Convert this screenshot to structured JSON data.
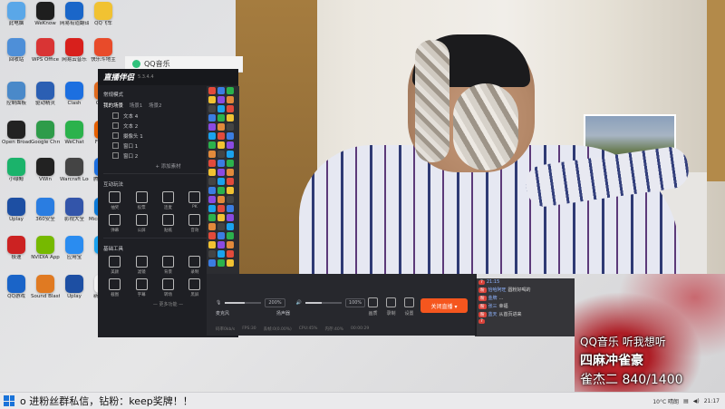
{
  "desktop_icons": [
    {
      "label": "此电脑",
      "icon": "computer-icon",
      "color": "#5aa7e8"
    },
    {
      "label": "WeKnow",
      "icon": "weknow-icon",
      "color": "#1e1e1e"
    },
    {
      "label": "网易有道翻译",
      "icon": "youdao-icon",
      "color": "#1a66c9"
    },
    {
      "label": "QQ飞车",
      "icon": "qq-speed-icon",
      "color": "#f1c232"
    },
    {
      "label": "回收站",
      "icon": "recycle-bin-icon",
      "color": "#4e8fd8"
    },
    {
      "label": "WPS Office",
      "icon": "wps-icon",
      "color": "#d93434"
    },
    {
      "label": "网易云音乐",
      "icon": "netease-music-icon",
      "color": "#d8201c"
    },
    {
      "label": "快乐斗地主",
      "icon": "doudizhu-icon",
      "color": "#e84b2a"
    },
    {
      "label": "控制面板",
      "icon": "control-panel-icon",
      "color": "#4a89c9"
    },
    {
      "label": "驱动精灵",
      "icon": "driver-icon",
      "color": "#2b5fb3"
    },
    {
      "label": "Clash",
      "icon": "clash-icon",
      "color": "#1c6fe0"
    },
    {
      "label": "Cpu-Z",
      "icon": "cpuz-icon",
      "color": "#e06a1e"
    },
    {
      "label": "Open Broadcast",
      "icon": "obs-icon",
      "color": "#222"
    },
    {
      "label": "Google Chrome",
      "icon": "chrome-icon",
      "color": "#2e9c4a"
    },
    {
      "label": "WeChat",
      "icon": "wechat-icon",
      "color": "#2bb24c"
    },
    {
      "label": "Firefox",
      "icon": "firefox-icon",
      "color": "#e66000"
    },
    {
      "label": "小绿鲸",
      "icon": "green-whale-icon",
      "color": "#1bb36b"
    },
    {
      "label": "VWin",
      "icon": "vwin-icon",
      "color": "#222"
    },
    {
      "label": "Warcraft Logs",
      "icon": "warcraft-icon",
      "color": "#444"
    },
    {
      "label": "腾讯会议",
      "icon": "tencent-meeting-icon",
      "color": "#1c6fe0"
    },
    {
      "label": "Uplay",
      "icon": "uplay-icon",
      "color": "#1d4fa3"
    },
    {
      "label": "360安全",
      "icon": "security-icon",
      "color": "#2a7de1"
    },
    {
      "label": "影视大全",
      "icon": "video-icon",
      "color": "#3355aa"
    },
    {
      "label": "Microsoft Edge",
      "icon": "edge-icon",
      "color": "#0c7ad8"
    },
    {
      "label": "极速",
      "icon": "jisu-icon",
      "color": "#cc2222"
    },
    {
      "label": "NVIDIA App",
      "icon": "nvidia-icon",
      "color": "#76b900"
    },
    {
      "label": "应用宝",
      "icon": "appstore-icon",
      "color": "#2a8cf0"
    },
    {
      "label": "QQ",
      "icon": "qq-icon",
      "color": "#1aa2ee"
    },
    {
      "label": "QQ游戏",
      "icon": "qq-game-icon",
      "color": "#1a64c8"
    },
    {
      "label": "Sound Blaster",
      "icon": "sound-blaster-icon",
      "color": "#e07a22"
    },
    {
      "label": "Uplay",
      "icon": "uplay2-icon",
      "color": "#1d4fa3"
    },
    {
      "label": "新建文件",
      "icon": "file-icon",
      "color": "#f2f2f2"
    }
  ],
  "qqmusic": {
    "title": "QQ音乐"
  },
  "stream_app": {
    "name": "直播伴侣",
    "version": "5.3.4.4",
    "mode_label": "常规模式",
    "mode_action": "编辑",
    "scene_tabs": [
      "我的场景",
      "场景1",
      "场景2"
    ],
    "sources": [
      "文本 4",
      "文本 2",
      "摄像头 1",
      "窗口 1",
      "窗口 2"
    ],
    "add_source": "+ 添加素材",
    "interact_title": "互动玩法",
    "interact_tools": [
      "抽奖",
      "投票",
      "连麦",
      "PK",
      "礼物",
      "弹幕",
      "公屏",
      "贴纸",
      "音效",
      "更多"
    ],
    "basic_title": "基础工具",
    "basic_tools": [
      "美颜",
      "滤镜",
      "背景",
      "录制",
      "设置",
      "截图",
      "字幕",
      "转场",
      "黑屏",
      "下载"
    ],
    "more_label": "— 更多功能 —"
  },
  "controls": {
    "mic_label": "麦克风",
    "mic_volume": "200%",
    "speaker_label": "扬声器",
    "speaker_volume": "100%",
    "screen_label": "画质",
    "record_label": "录制",
    "settings_label": "设置",
    "go_live": "关闭直播 ▾",
    "stats": [
      "码率0kb/s",
      "FPS:30",
      "丢帧:0(0.00%)",
      "CPU:45%",
      "内存:40%",
      "00:00:29"
    ],
    "mic_fill": 0.55,
    "speaker_fill": 0.45
  },
  "chat": {
    "messages": [
      {
        "badge": "7",
        "name": "21:15",
        "text": ""
      },
      {
        "badge": "粉",
        "name": "恰哈阿旺",
        "text": "圆粉好喝的"
      },
      {
        "badge": "粉",
        "name": "金牌",
        "text": "…"
      },
      {
        "badge": "粉",
        "name": "张三",
        "text": "幸福"
      },
      {
        "badge": "粉",
        "name": "蓝天",
        "text": "从首页进来"
      },
      {
        "badge": "7",
        "name": "",
        "text": ""
      }
    ]
  },
  "overlay": {
    "line1": "QQ音乐 听我想听",
    "line2": "四麻冲雀豪",
    "line3": "雀杰二 840/1400"
  },
  "taskbar": {
    "ticker": "o 进粉丝群私信，钻粉：keep奖牌！！",
    "weather": "10°C 晴朗",
    "time": "21:17"
  }
}
